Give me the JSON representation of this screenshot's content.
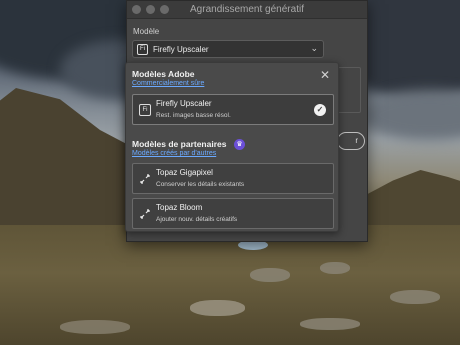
{
  "window": {
    "title": "Agrandissement génératif",
    "model_label": "Modèle",
    "selected_model": "Firefly Upscaler",
    "firefly_icon": "Fi",
    "behind_button_fragment": "r"
  },
  "popover": {
    "adobe_section": {
      "title": "Modèles Adobe",
      "link": "Commercialement sûre",
      "models": [
        {
          "name": "Firefly Upscaler",
          "description": "Rest. images basse résol.",
          "selected": true,
          "icon": "firefly-icon"
        }
      ]
    },
    "partner_section": {
      "title": "Modèles de partenaires",
      "link": "Modèles créés par d'autres",
      "badge_icon": "crown-icon",
      "models": [
        {
          "name": "Topaz Gigapixel",
          "description": "Conserver les détails existants",
          "icon": "upscale-arrows-icon"
        },
        {
          "name": "Topaz Bloom",
          "description": "Ajouter nouv. détails créatifs",
          "icon": "upscale-arrows-icon"
        }
      ]
    }
  },
  "colors": {
    "link": "#6aa9ff",
    "badge": "#6b4fd8",
    "panel": "#4a4a4a"
  }
}
